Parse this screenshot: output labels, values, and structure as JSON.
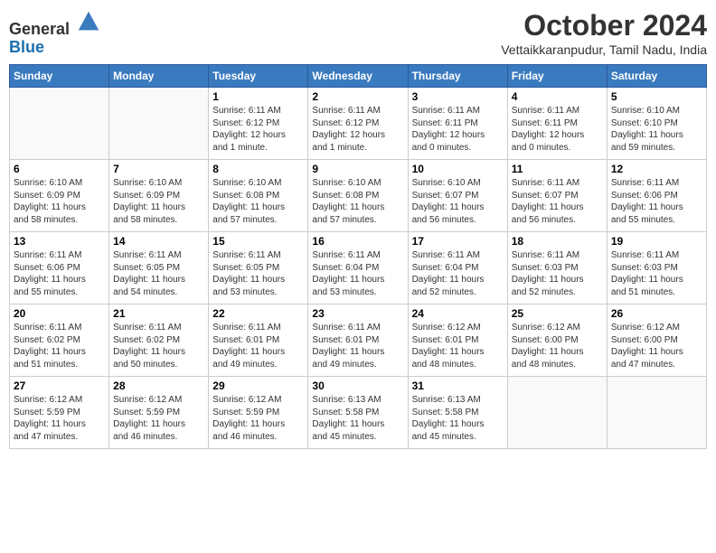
{
  "header": {
    "logo_line1": "General",
    "logo_line2": "Blue",
    "month_title": "October 2024",
    "location": "Vettaikkaranpudur, Tamil Nadu, India"
  },
  "days_of_week": [
    "Sunday",
    "Monday",
    "Tuesday",
    "Wednesday",
    "Thursday",
    "Friday",
    "Saturday"
  ],
  "weeks": [
    [
      {
        "day": "",
        "info": ""
      },
      {
        "day": "",
        "info": ""
      },
      {
        "day": "1",
        "info": "Sunrise: 6:11 AM\nSunset: 6:12 PM\nDaylight: 12 hours\nand 1 minute."
      },
      {
        "day": "2",
        "info": "Sunrise: 6:11 AM\nSunset: 6:12 PM\nDaylight: 12 hours\nand 1 minute."
      },
      {
        "day": "3",
        "info": "Sunrise: 6:11 AM\nSunset: 6:11 PM\nDaylight: 12 hours\nand 0 minutes."
      },
      {
        "day": "4",
        "info": "Sunrise: 6:11 AM\nSunset: 6:11 PM\nDaylight: 12 hours\nand 0 minutes."
      },
      {
        "day": "5",
        "info": "Sunrise: 6:10 AM\nSunset: 6:10 PM\nDaylight: 11 hours\nand 59 minutes."
      }
    ],
    [
      {
        "day": "6",
        "info": "Sunrise: 6:10 AM\nSunset: 6:09 PM\nDaylight: 11 hours\nand 58 minutes."
      },
      {
        "day": "7",
        "info": "Sunrise: 6:10 AM\nSunset: 6:09 PM\nDaylight: 11 hours\nand 58 minutes."
      },
      {
        "day": "8",
        "info": "Sunrise: 6:10 AM\nSunset: 6:08 PM\nDaylight: 11 hours\nand 57 minutes."
      },
      {
        "day": "9",
        "info": "Sunrise: 6:10 AM\nSunset: 6:08 PM\nDaylight: 11 hours\nand 57 minutes."
      },
      {
        "day": "10",
        "info": "Sunrise: 6:10 AM\nSunset: 6:07 PM\nDaylight: 11 hours\nand 56 minutes."
      },
      {
        "day": "11",
        "info": "Sunrise: 6:11 AM\nSunset: 6:07 PM\nDaylight: 11 hours\nand 56 minutes."
      },
      {
        "day": "12",
        "info": "Sunrise: 6:11 AM\nSunset: 6:06 PM\nDaylight: 11 hours\nand 55 minutes."
      }
    ],
    [
      {
        "day": "13",
        "info": "Sunrise: 6:11 AM\nSunset: 6:06 PM\nDaylight: 11 hours\nand 55 minutes."
      },
      {
        "day": "14",
        "info": "Sunrise: 6:11 AM\nSunset: 6:05 PM\nDaylight: 11 hours\nand 54 minutes."
      },
      {
        "day": "15",
        "info": "Sunrise: 6:11 AM\nSunset: 6:05 PM\nDaylight: 11 hours\nand 53 minutes."
      },
      {
        "day": "16",
        "info": "Sunrise: 6:11 AM\nSunset: 6:04 PM\nDaylight: 11 hours\nand 53 minutes."
      },
      {
        "day": "17",
        "info": "Sunrise: 6:11 AM\nSunset: 6:04 PM\nDaylight: 11 hours\nand 52 minutes."
      },
      {
        "day": "18",
        "info": "Sunrise: 6:11 AM\nSunset: 6:03 PM\nDaylight: 11 hours\nand 52 minutes."
      },
      {
        "day": "19",
        "info": "Sunrise: 6:11 AM\nSunset: 6:03 PM\nDaylight: 11 hours\nand 51 minutes."
      }
    ],
    [
      {
        "day": "20",
        "info": "Sunrise: 6:11 AM\nSunset: 6:02 PM\nDaylight: 11 hours\nand 51 minutes."
      },
      {
        "day": "21",
        "info": "Sunrise: 6:11 AM\nSunset: 6:02 PM\nDaylight: 11 hours\nand 50 minutes."
      },
      {
        "day": "22",
        "info": "Sunrise: 6:11 AM\nSunset: 6:01 PM\nDaylight: 11 hours\nand 49 minutes."
      },
      {
        "day": "23",
        "info": "Sunrise: 6:11 AM\nSunset: 6:01 PM\nDaylight: 11 hours\nand 49 minutes."
      },
      {
        "day": "24",
        "info": "Sunrise: 6:12 AM\nSunset: 6:01 PM\nDaylight: 11 hours\nand 48 minutes."
      },
      {
        "day": "25",
        "info": "Sunrise: 6:12 AM\nSunset: 6:00 PM\nDaylight: 11 hours\nand 48 minutes."
      },
      {
        "day": "26",
        "info": "Sunrise: 6:12 AM\nSunset: 6:00 PM\nDaylight: 11 hours\nand 47 minutes."
      }
    ],
    [
      {
        "day": "27",
        "info": "Sunrise: 6:12 AM\nSunset: 5:59 PM\nDaylight: 11 hours\nand 47 minutes."
      },
      {
        "day": "28",
        "info": "Sunrise: 6:12 AM\nSunset: 5:59 PM\nDaylight: 11 hours\nand 46 minutes."
      },
      {
        "day": "29",
        "info": "Sunrise: 6:12 AM\nSunset: 5:59 PM\nDaylight: 11 hours\nand 46 minutes."
      },
      {
        "day": "30",
        "info": "Sunrise: 6:13 AM\nSunset: 5:58 PM\nDaylight: 11 hours\nand 45 minutes."
      },
      {
        "day": "31",
        "info": "Sunrise: 6:13 AM\nSunset: 5:58 PM\nDaylight: 11 hours\nand 45 minutes."
      },
      {
        "day": "",
        "info": ""
      },
      {
        "day": "",
        "info": ""
      }
    ]
  ]
}
